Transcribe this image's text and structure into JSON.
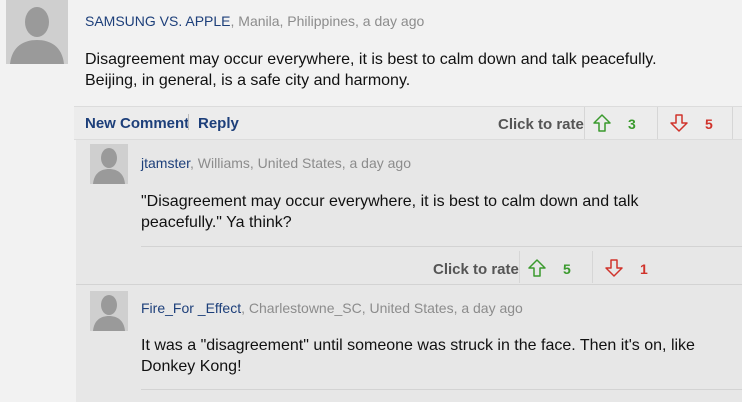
{
  "comments": [
    {
      "author": "SAMSUNG VS. APPLE",
      "meta": ", Manila, Philippines, a day ago",
      "text": "Disagreement may occur everywhere, it is best to calm down and talk peacefully. Beijing, in general, is a safe city and harmony.",
      "actions": {
        "new_comment": "New Comment",
        "reply": "Reply"
      },
      "rate_label": "Click to rate",
      "up": "3",
      "down": "5"
    },
    {
      "author": "jtamster",
      "meta": ", Williams, United States, a day ago",
      "text": "\"Disagreement may occur everywhere, it is best to calm down and talk peacefully.\" Ya think?",
      "rate_label": "Click to rate",
      "up": "5",
      "down": "1"
    },
    {
      "author": "Fire_For _Effect",
      "meta": ", Charlestowne_SC, United States, a day ago",
      "text": "It was a \"disagreement\" until someone was struck in the face. Then it's on, like Donkey Kong!"
    }
  ],
  "colors": {
    "author": "#1d3f7a",
    "meta": "#8c8c8c",
    "up": "#3a9a2d",
    "down": "#d0332b"
  }
}
